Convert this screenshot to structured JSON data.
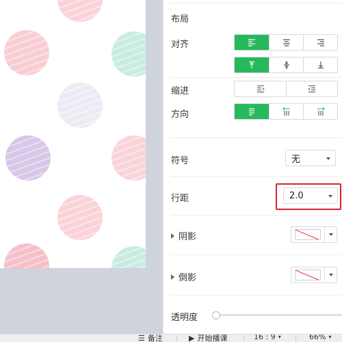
{
  "panel": {
    "layout_title": "布局",
    "align_label": "对齐",
    "indent_label": "缩进",
    "direction_label": "方向",
    "symbol_label": "符号",
    "symbol_value": "无",
    "line_spacing_label": "行距",
    "line_spacing_value": "2.0",
    "shadow_label": "阴影",
    "reflection_label": "倒影",
    "opacity_label": "透明度",
    "opacity_value": 0
  },
  "statusbar": {
    "notes_label": "备注",
    "play_label": "开始播课",
    "ratio_label": "16 : 9",
    "zoom_label": "66%"
  },
  "colors": {
    "accent": "#27b85c",
    "highlight": "#d9232b",
    "dot_pink": "#f7c9d0",
    "dot_mint": "#c6ebe1",
    "dot_lavender": "#e9e6f3",
    "dot_purple": "#d5c3e6"
  }
}
